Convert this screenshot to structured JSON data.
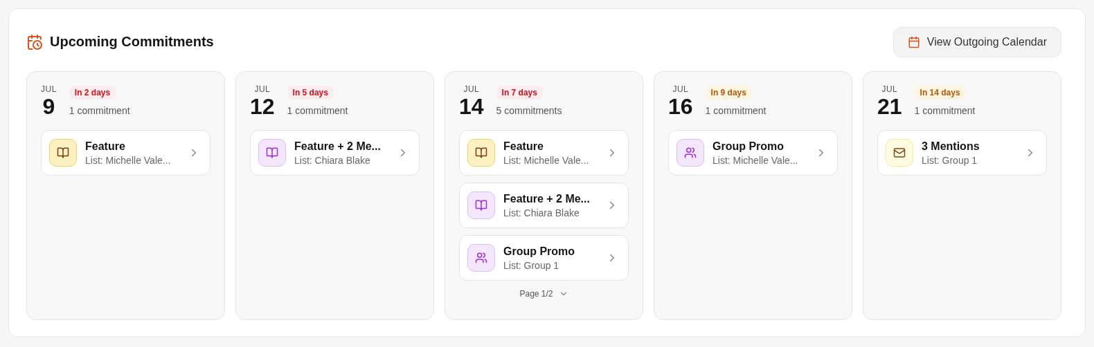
{
  "header": {
    "title": "Upcoming Commitments",
    "button": "View Outgoing Calendar"
  },
  "days": [
    {
      "month": "JUL",
      "day": "9",
      "badge": {
        "text": "In 2 days",
        "kind": "urgent"
      },
      "count": "1 commitment",
      "items": [
        {
          "title": "Feature",
          "list": "List: Michelle Vale...",
          "kind": "book",
          "color": "#fdf1c4"
        }
      ]
    },
    {
      "month": "JUL",
      "day": "12",
      "badge": {
        "text": "In 5 days",
        "kind": "urgent"
      },
      "count": "1 commitment",
      "items": [
        {
          "title": "Feature + 2 Me...",
          "list": "List: Chiara Blake",
          "kind": "book",
          "color": "#f3e6fd"
        }
      ]
    },
    {
      "month": "JUL",
      "day": "14",
      "badge": {
        "text": "In 7 days",
        "kind": "urgent"
      },
      "count": "5 commitments",
      "items": [
        {
          "title": "Feature",
          "list": "List: Michelle Vale...",
          "kind": "book",
          "color": "#fdf1c4"
        },
        {
          "title": "Feature + 2 Me...",
          "list": "List: Chiara Blake",
          "kind": "book",
          "color": "#f3e6fd"
        },
        {
          "title": "Group Promo",
          "list": "List: Group 1",
          "kind": "people",
          "color": "#f3e6fd"
        }
      ],
      "pager": "Page 1/2"
    },
    {
      "month": "JUL",
      "day": "16",
      "badge": {
        "text": "In 9 days",
        "kind": "soon"
      },
      "count": "1 commitment",
      "items": [
        {
          "title": "Group Promo",
          "list": "List: Michelle Vale...",
          "kind": "people",
          "color": "#f3e6fd"
        }
      ]
    },
    {
      "month": "JUL",
      "day": "21",
      "badge": {
        "text": "In 14 days",
        "kind": "soon"
      },
      "count": "1 commitment",
      "items": [
        {
          "title": "3 Mentions",
          "list": "List: Group 1",
          "kind": "mail",
          "color": "#fefbe0"
        }
      ]
    }
  ]
}
